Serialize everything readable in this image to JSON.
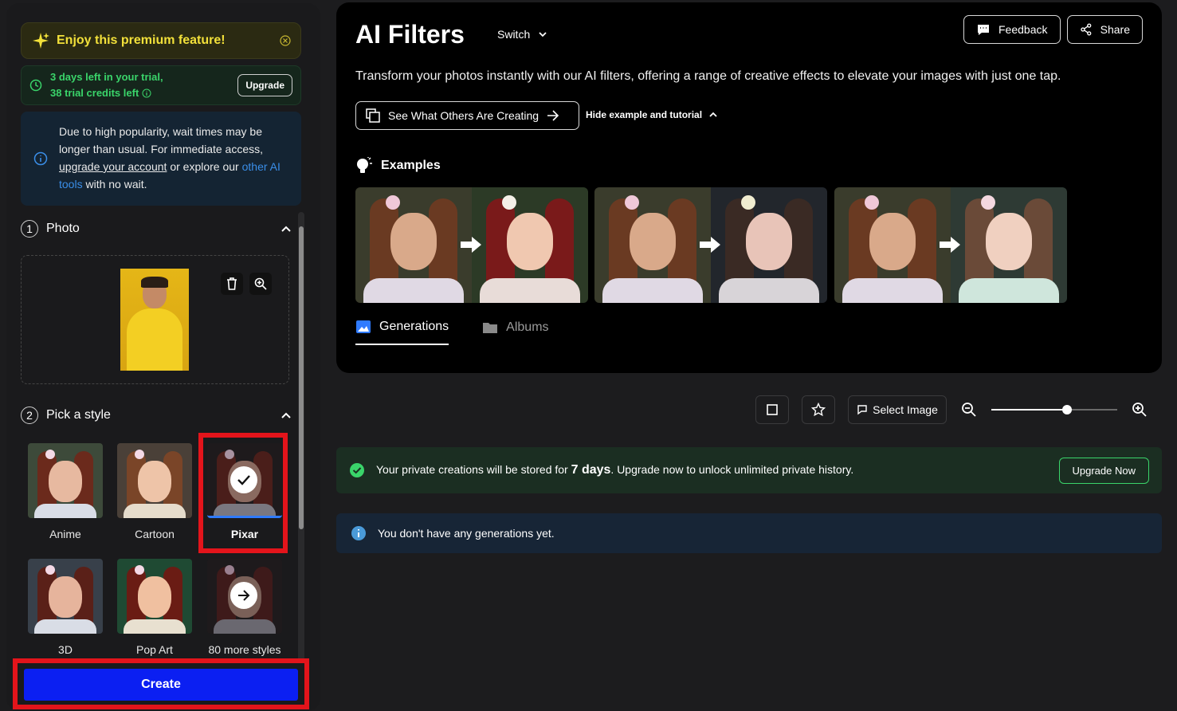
{
  "sidebar": {
    "premium_text": "Enjoy this premium feature!",
    "trial_line1": "3 days left in your trial,",
    "trial_line2": "38 trial credits left",
    "upgrade_label": "Upgrade",
    "notice_1": "Due to high popularity, wait times may be longer than usual. For immediate access,",
    "notice_link1": "upgrade your account",
    "notice_2": " or explore our ",
    "notice_link2": "other AI tools",
    "notice_3": " with no wait.",
    "step1_num": "1",
    "step1_title": "Photo",
    "step2_num": "2",
    "step2_title": "Pick a style",
    "styles": [
      {
        "label": "Anime"
      },
      {
        "label": "Cartoon"
      },
      {
        "label": "Pixar"
      },
      {
        "label": "3D"
      },
      {
        "label": "Pop Art"
      },
      {
        "label": "80 more styles"
      }
    ],
    "selected_style": "Pixar",
    "create_label": "Create"
  },
  "main": {
    "title": "AI Filters",
    "switch_label": "Switch",
    "feedback_label": "Feedback",
    "share_label": "Share",
    "description": "Transform your photos instantly with our AI filters, offering a range of creative effects to elevate your images with just one tap.",
    "see_others_label": "See What Others Are Creating",
    "hide_label": "Hide example and tutorial",
    "examples_title": "Examples",
    "tabs": [
      {
        "label": "Generations",
        "active": true
      },
      {
        "label": "Albums",
        "active": false
      }
    ]
  },
  "toolbar": {
    "select_image_label": "Select Image",
    "zoom_level": 0.6
  },
  "banner": {
    "text_before": "Your private creations will be stored for ",
    "days": "7 days",
    "text_after": ". Upgrade now to unlock unlimited private history.",
    "upgrade_now_label": "Upgrade Now"
  },
  "empty_state": {
    "message": "You don't have any generations yet."
  },
  "colors": {
    "accent_blue": "#0b1ff2",
    "success_green": "#3ad46a",
    "highlight_red": "#e3141b",
    "premium_yellow": "#f2e03a",
    "link_blue": "#3a8ee8"
  }
}
